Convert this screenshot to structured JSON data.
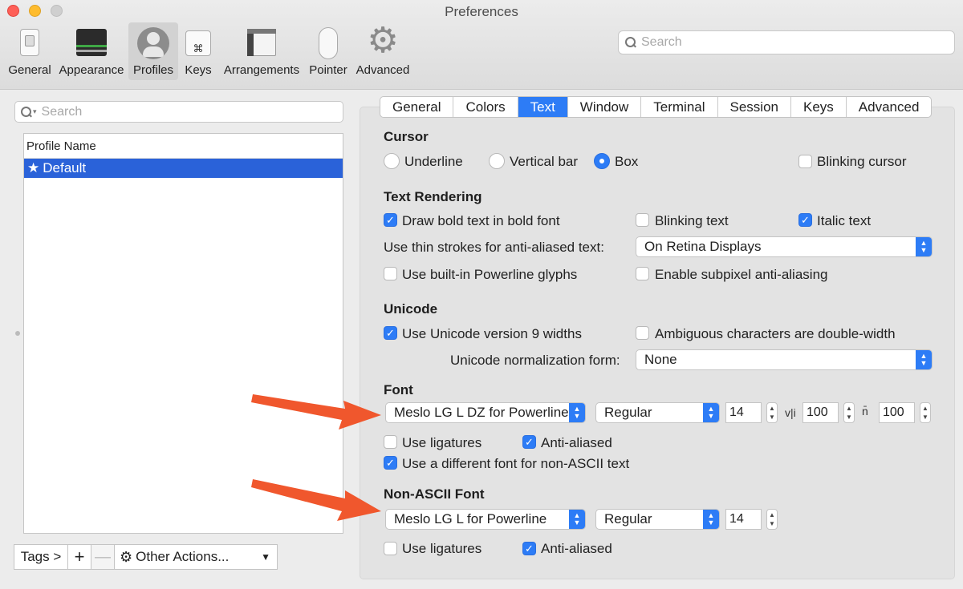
{
  "window": {
    "title": "Preferences"
  },
  "toolbar": {
    "items": [
      {
        "label": "General"
      },
      {
        "label": "Appearance"
      },
      {
        "label": "Profiles"
      },
      {
        "label": "Keys"
      },
      {
        "label": "Arrangements"
      },
      {
        "label": "Pointer"
      },
      {
        "label": "Advanced"
      }
    ],
    "active": "Profiles",
    "search_placeholder": "Search"
  },
  "sidebar": {
    "search_placeholder": "Search",
    "list_header": "Profile Name",
    "profiles": [
      {
        "name": "Default",
        "default": true,
        "selected": true
      }
    ],
    "tags_button": "Tags >",
    "add_button": "+",
    "remove_button": "—",
    "other_actions": "Other Actions..."
  },
  "tabs": {
    "items": [
      "General",
      "Colors",
      "Text",
      "Window",
      "Terminal",
      "Session",
      "Keys",
      "Advanced"
    ],
    "active": "Text"
  },
  "cursor": {
    "heading": "Cursor",
    "underline": "Underline",
    "vertical_bar": "Vertical bar",
    "box": "Box",
    "selected": "Box",
    "blinking": "Blinking cursor",
    "blinking_checked": false
  },
  "text_rendering": {
    "heading": "Text Rendering",
    "bold": "Draw bold text in bold font",
    "bold_checked": true,
    "blinking_text": "Blinking text",
    "blinking_text_checked": false,
    "italic": "Italic text",
    "italic_checked": true,
    "thin_strokes_label": "Use thin strokes for anti-aliased text:",
    "thin_strokes_value": "On Retina Displays",
    "powerline": "Use built-in Powerline glyphs",
    "powerline_checked": false,
    "subpixel": "Enable subpixel anti-aliasing",
    "subpixel_checked": false
  },
  "unicode": {
    "heading": "Unicode",
    "v9": "Use Unicode version 9 widths",
    "v9_checked": true,
    "ambiguous": "Ambiguous characters are double-width",
    "ambiguous_checked": false,
    "normalization_label": "Unicode normalization form:",
    "normalization_value": "None"
  },
  "font": {
    "heading": "Font",
    "family": "Meslo LG L DZ for Powerline",
    "style": "Regular",
    "size": "14",
    "vspacing": "100",
    "hspacing": "100",
    "ligatures": "Use ligatures",
    "ligatures_checked": false,
    "antialiased": "Anti-aliased",
    "antialiased_checked": true,
    "non_ascii_toggle": "Use a different font for non-ASCII text",
    "non_ascii_toggle_checked": true
  },
  "non_ascii_font": {
    "heading": "Non-ASCII Font",
    "family": "Meslo LG L for Powerline",
    "style": "Regular",
    "size": "14",
    "ligatures": "Use ligatures",
    "ligatures_checked": false,
    "antialiased": "Anti-aliased",
    "antialiased_checked": true
  },
  "colors": {
    "accent": "#2d7cf6",
    "selection": "#2a62d9",
    "annotation_arrow": "#f0572d"
  }
}
